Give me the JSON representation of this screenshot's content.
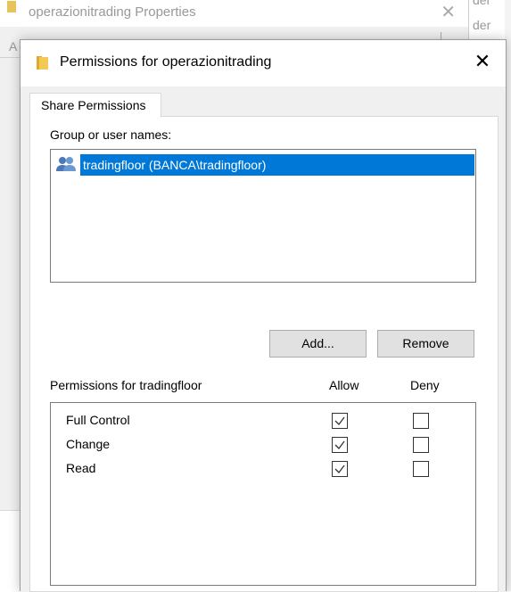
{
  "background_window": {
    "title": "operazionitrading Properties",
    "tab_partial": "A",
    "side_labels": [
      "der",
      "der"
    ]
  },
  "dialog": {
    "title": "Permissions for operazionitrading",
    "close_glyph": "✕",
    "tab_label": "Share Permissions",
    "group_label": "Group or user names:",
    "users": [
      {
        "name": "tradingfloor (BANCA\\tradingfloor)",
        "selected": true,
        "icon": "users-group-icon"
      }
    ],
    "add_button": "Add...",
    "remove_button": "Remove",
    "permissions_label": "Permissions for tradingfloor",
    "allow_header": "Allow",
    "deny_header": "Deny",
    "permissions": [
      {
        "name": "Full Control",
        "allow": true,
        "deny": false
      },
      {
        "name": "Change",
        "allow": true,
        "deny": false
      },
      {
        "name": "Read",
        "allow": true,
        "deny": false
      }
    ]
  },
  "colors": {
    "selection": "#0078d7",
    "dialog_body": "#f0f0f0",
    "button_face": "#e1e1e1",
    "folder": "#e8c25a"
  }
}
